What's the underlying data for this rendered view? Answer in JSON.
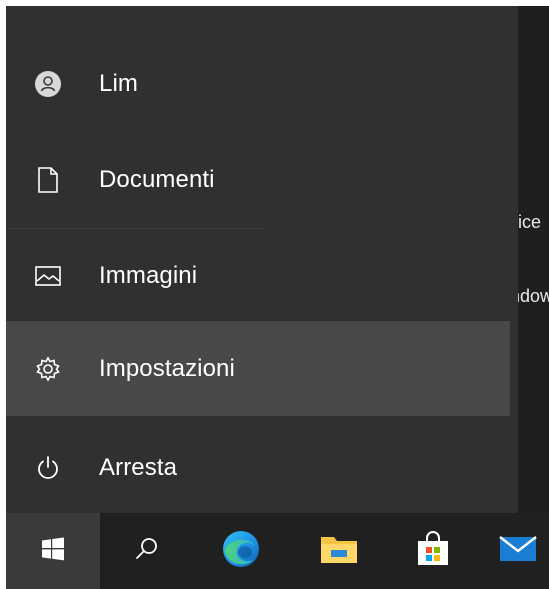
{
  "start_menu": {
    "items": [
      {
        "label": "Lim",
        "icon": "user-avatar-icon"
      },
      {
        "label": "Documenti",
        "icon": "document-icon"
      },
      {
        "label": "Immagini",
        "icon": "pictures-icon"
      },
      {
        "label": "Impostazioni",
        "icon": "gear-icon",
        "highlighted": true
      },
      {
        "label": "Arresta",
        "icon": "power-icon"
      }
    ]
  },
  "background_window": {
    "text_1": "ice",
    "text_2": "ndow"
  },
  "taskbar": {
    "buttons": [
      {
        "name": "start",
        "icon": "windows-logo-icon",
        "active": true
      },
      {
        "name": "search",
        "icon": "search-icon"
      },
      {
        "name": "edge",
        "icon": "edge-browser-icon"
      },
      {
        "name": "file-explorer",
        "icon": "folder-icon"
      },
      {
        "name": "store",
        "icon": "store-icon"
      },
      {
        "name": "mail",
        "icon": "mail-icon"
      }
    ]
  },
  "colors": {
    "menu_bg": "#303030",
    "highlight_bg": "#484848",
    "taskbar_bg": "#202020",
    "text": "#ffffff"
  }
}
